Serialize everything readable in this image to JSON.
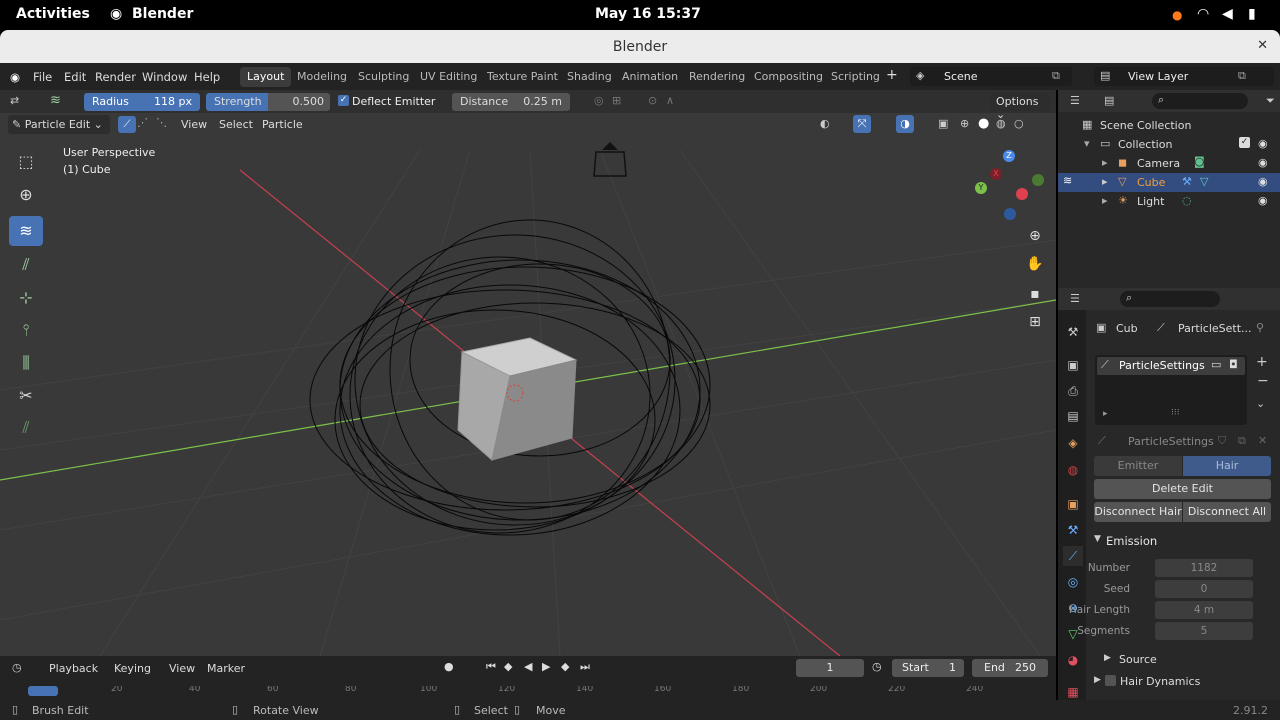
{
  "gnome": {
    "activities": "Activities",
    "app": "Blender",
    "clock": "May 16  15:37"
  },
  "window": {
    "title": "Blender",
    "close": "✕"
  },
  "menus": [
    "File",
    "Edit",
    "Render",
    "Window",
    "Help"
  ],
  "workspaces": [
    "Layout",
    "Modeling",
    "Sculpting",
    "UV Editing",
    "Texture Paint",
    "Shading",
    "Animation",
    "Rendering",
    "Compositing",
    "Scripting"
  ],
  "scene": {
    "name": "Scene",
    "view_layer": "View Layer"
  },
  "tool_header": {
    "radius_label": "Radius",
    "radius_value": "118 px",
    "strength_label": "Strength",
    "strength_value": "0.500",
    "deflect_label": "Deflect Emitter",
    "distance_label": "Distance",
    "distance_value": "0.25 m",
    "options": "Options"
  },
  "viewport_header": {
    "mode": "Particle Edit",
    "view": "View",
    "select": "Select",
    "particle": "Particle"
  },
  "viewport": {
    "perspective": "User Perspective",
    "object": "(1) Cube"
  },
  "gizmo": {
    "x": "X",
    "y": "Y",
    "z": "Z"
  },
  "outliner": {
    "scene_collection": "Scene Collection",
    "collection": "Collection",
    "items": [
      "Camera",
      "Cube",
      "Light"
    ]
  },
  "properties": {
    "breadcrumb_obj": "Cub",
    "breadcrumb_set": "ParticleSett...",
    "slot_name": "ParticleSettings",
    "settings_name": "ParticleSettings",
    "type_emitter": "Emitter",
    "type_hair": "Hair",
    "delete_edit": "Delete Edit",
    "disconnect_hair": "Disconnect Hair",
    "disconnect_all": "Disconnect All",
    "emission": "Emission",
    "fields": [
      {
        "label": "Number",
        "value": "1182"
      },
      {
        "label": "Seed",
        "value": "0"
      },
      {
        "label": "Hair Length",
        "value": "4 m"
      },
      {
        "label": "Segments",
        "value": "5"
      }
    ],
    "source": "Source",
    "hair_dynamics": "Hair Dynamics"
  },
  "timeline": {
    "playback": "Playback",
    "keying": "Keying",
    "view": "View",
    "marker": "Marker",
    "current_frame": "1",
    "start_label": "Start",
    "start": "1",
    "end_label": "End",
    "end": "250",
    "ticks": [
      "20",
      "40",
      "60",
      "80",
      "100",
      "120",
      "140",
      "160",
      "180",
      "200",
      "220",
      "240"
    ]
  },
  "status": {
    "brush_edit": "Brush Edit",
    "rotate_view": "Rotate View",
    "select": "Select",
    "move": "Move",
    "version": "2.91.2"
  },
  "colors": {
    "accent": "#4772b3",
    "x_axis": "#e04050",
    "y_axis": "#7cc24a",
    "z_axis": "#4a8ae8",
    "selected_row": "#334d80"
  }
}
